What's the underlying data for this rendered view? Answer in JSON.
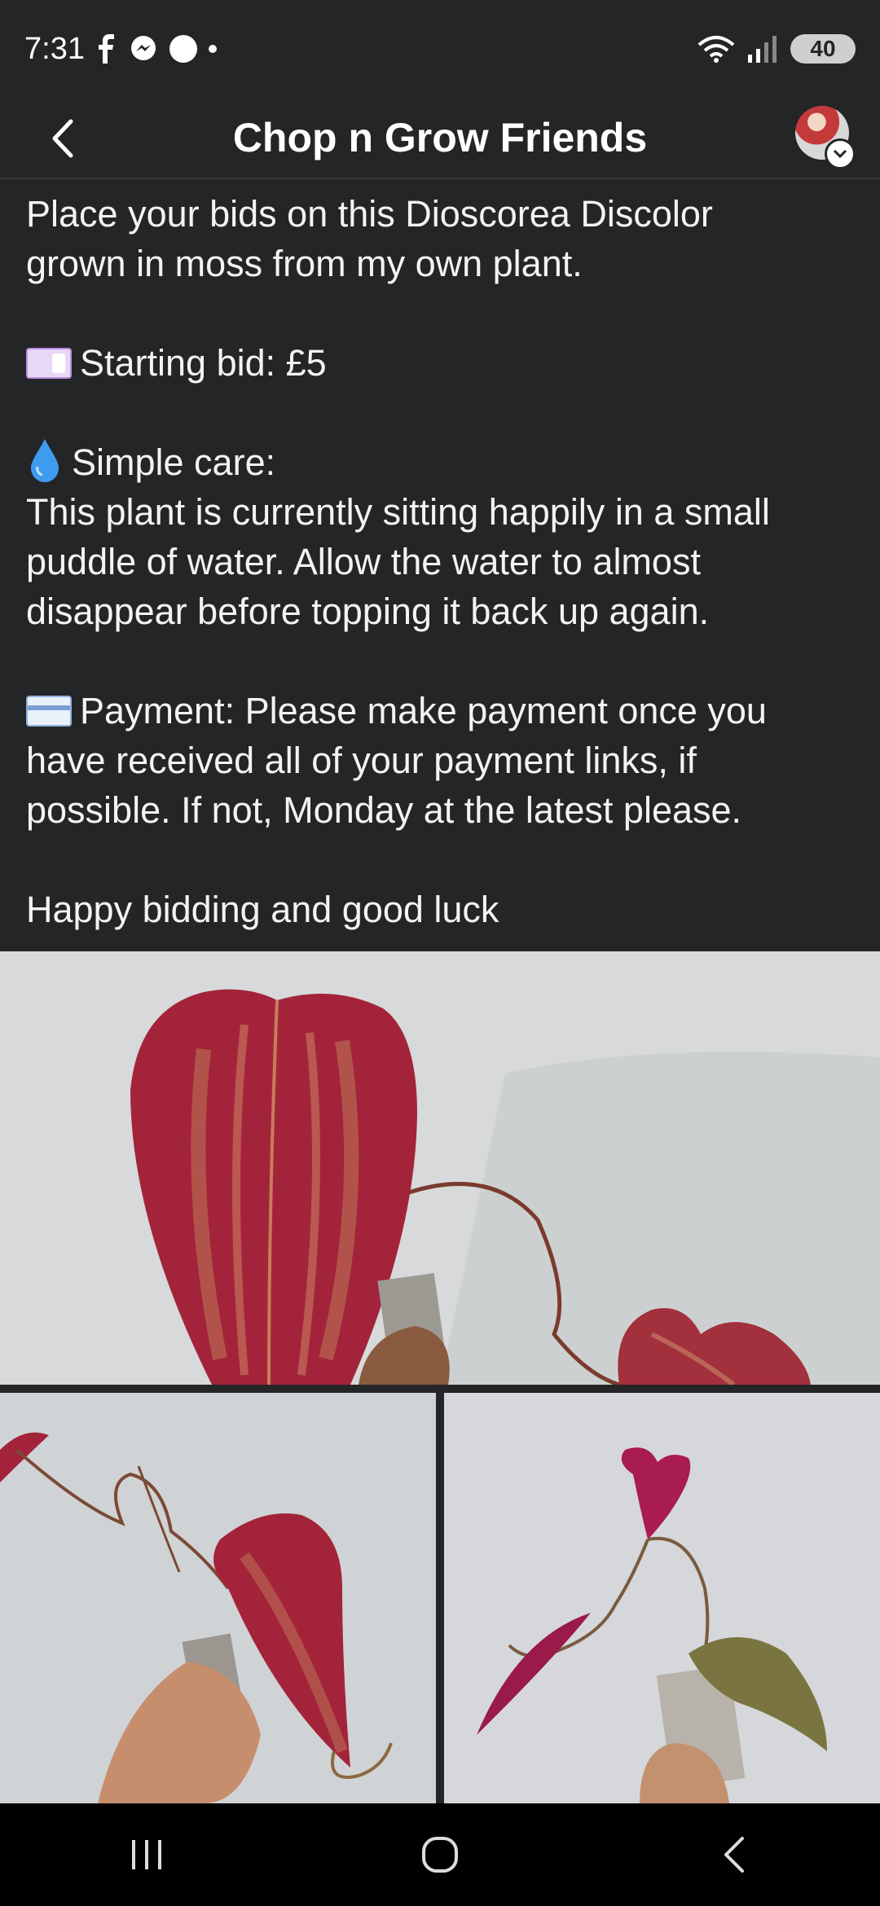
{
  "status_bar": {
    "time": "7:31",
    "battery": "40",
    "icons": [
      "facebook-icon",
      "messenger-icon",
      "dot-icon",
      "wifi-icon",
      "signal-icon"
    ]
  },
  "header": {
    "title": "Chop n Grow Friends",
    "back_icon": "chevron-left-icon",
    "avatar_badge_icon": "chevron-down-icon"
  },
  "post": {
    "intro_line1": "Place your bids on this Dioscorea Discolor",
    "intro_line2": "grown in moss from my own plant.",
    "starting_bid": "Starting bid: £5",
    "care_title": "Simple care:",
    "care_line1": "This plant is currently sitting happily in a small",
    "care_line2": "puddle of water. Allow the water to almost",
    "care_line3": "disappear before topping it back up again.",
    "payment_line1": "Payment: Please make payment once you",
    "payment_line2": "have received all of your payment links, if",
    "payment_line3": "possible. If not, Monday at the latest please.",
    "closing": "Happy bidding and good luck"
  },
  "photos": [
    "plant-photo-leaf-closeup",
    "plant-photo-hand-left",
    "plant-photo-pot-right"
  ],
  "colors": {
    "background": "#242527",
    "text": "#f2f3f5",
    "leaf": "#a3243a"
  },
  "nav_bar": {
    "icons": [
      "recent-apps-icon",
      "home-icon",
      "back-icon"
    ]
  }
}
